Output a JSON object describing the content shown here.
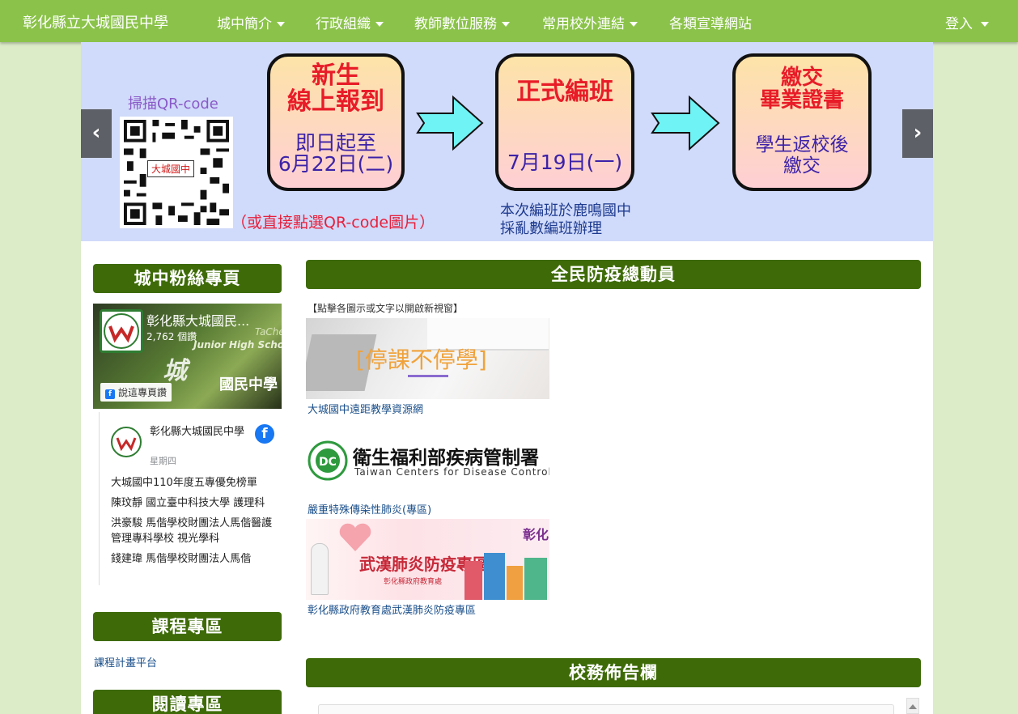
{
  "nav": {
    "brand": "彰化縣立大城國民中學",
    "items": [
      "城中簡介",
      "行政組織",
      "教師數位服務",
      "常用校外連結",
      "各類宣導網站"
    ],
    "login": "登入"
  },
  "slider": {
    "prev": "‹",
    "next": "›",
    "qr_caption": "掃描QR-code",
    "qr_label": "大城國中",
    "qr_note": "（或直接點選QR-code圖片）",
    "step1_title_1": "新生",
    "step1_title_2": "線上報到",
    "step1_date_1": "即日起至",
    "step1_date_2": "6月22日(二)",
    "step2_title": "正式編班",
    "step2_date": "7月19日(一)",
    "step2_note_1": "本次編班於鹿鳴國中",
    "step2_note_2": "採亂數編班辦理",
    "step3_title_1": "繳交",
    "step3_title_2": "畢業證書",
    "step3_sub_1": "學生返校後",
    "step3_sub_2": "繳交"
  },
  "sidebar": {
    "fans_title": "城中粉絲專頁",
    "fb": {
      "page_name": "彰化縣大城國民...",
      "likes": "2,762 個讚",
      "watermark": "城",
      "watermark2": "國民中學",
      "cover_en": "TaChe",
      "cover_en2": "Junior High Scho",
      "like_button": "說這專頁讚",
      "post_author": "彰化縣大城國民中學",
      "post_day": "星期四",
      "post_lines": [
        "大城國中110年度五專優免榜單",
        "陳玟靜 國立臺中科技大學 護理科",
        "洪豪駿 馬偕學校財團法人馬偕醫護管理專科學校 視光學科",
        "錢建瑋 馬偕學校財團法人馬偕"
      ]
    },
    "course_title": "課程專區",
    "course_link": "課程計畫平台",
    "reading_title": "閱讀專區"
  },
  "main": {
    "covid_title": "全民防疫總動員",
    "hint": "【點擊各圖示或文字以開啟新視窗】",
    "tile1_text": "[停課不停學]",
    "tile1_link": "大城國中遠距教學資源網",
    "cdc_name_zh": "衛生福利部疾病管制署",
    "cdc_name_en": "Taiwan Centers for Disease Control",
    "cdc_link": "嚴重特殊傳染性肺炎(專區)",
    "tile3_title": "武漢肺炎防疫專區",
    "tile3_sub": "彰化縣政府教育處",
    "tile3_badge": "彰化",
    "tile3_link": "彰化縣政府教育處武漢肺炎防疫專區",
    "bulletin_title": "校務佈告欄"
  },
  "colors": {
    "navbar": "#8bc34a",
    "panel_head": "#3e6b08",
    "link": "#1a4f8a",
    "page_bg": "#dcebc8"
  }
}
